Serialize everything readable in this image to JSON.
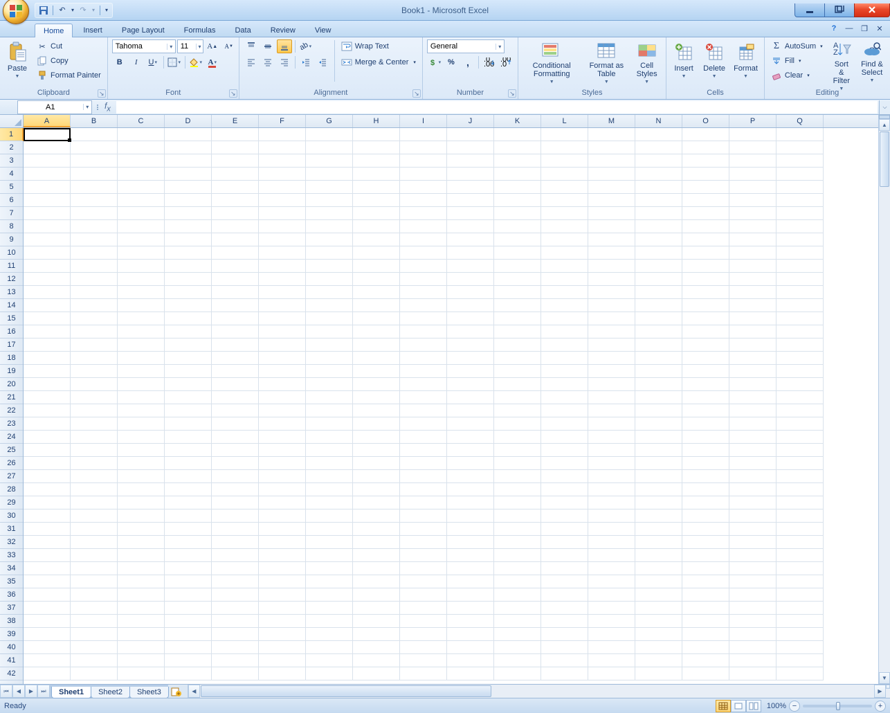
{
  "title": "Book1 - Microsoft Excel",
  "tabs": [
    "Home",
    "Insert",
    "Page Layout",
    "Formulas",
    "Data",
    "Review",
    "View"
  ],
  "active_tab": "Home",
  "ribbon": {
    "clipboard": {
      "title": "Clipboard",
      "paste": "Paste",
      "cut": "Cut",
      "copy": "Copy",
      "fmt": "Format Painter"
    },
    "font": {
      "title": "Font",
      "name": "Tahoma",
      "size": "11"
    },
    "alignment": {
      "title": "Alignment",
      "wrap": "Wrap Text",
      "merge": "Merge & Center"
    },
    "number": {
      "title": "Number",
      "format": "General"
    },
    "styles": {
      "title": "Styles",
      "cond": "Conditional Formatting",
      "table": "Format as Table",
      "cell": "Cell Styles"
    },
    "cells": {
      "title": "Cells",
      "insert": "Insert",
      "delete": "Delete",
      "format": "Format"
    },
    "editing": {
      "title": "Editing",
      "sum": "AutoSum",
      "fill": "Fill",
      "clear": "Clear",
      "sort": "Sort & Filter",
      "find": "Find & Select"
    }
  },
  "namebox": "A1",
  "formula": "",
  "columns": [
    "A",
    "B",
    "C",
    "D",
    "E",
    "F",
    "G",
    "H",
    "I",
    "J",
    "K",
    "L",
    "M",
    "N",
    "O",
    "P",
    "Q"
  ],
  "row_count": 42,
  "active_cell": "A1",
  "sheets": [
    "Sheet1",
    "Sheet2",
    "Sheet3"
  ],
  "active_sheet": "Sheet1",
  "status": "Ready",
  "zoom": "100%"
}
